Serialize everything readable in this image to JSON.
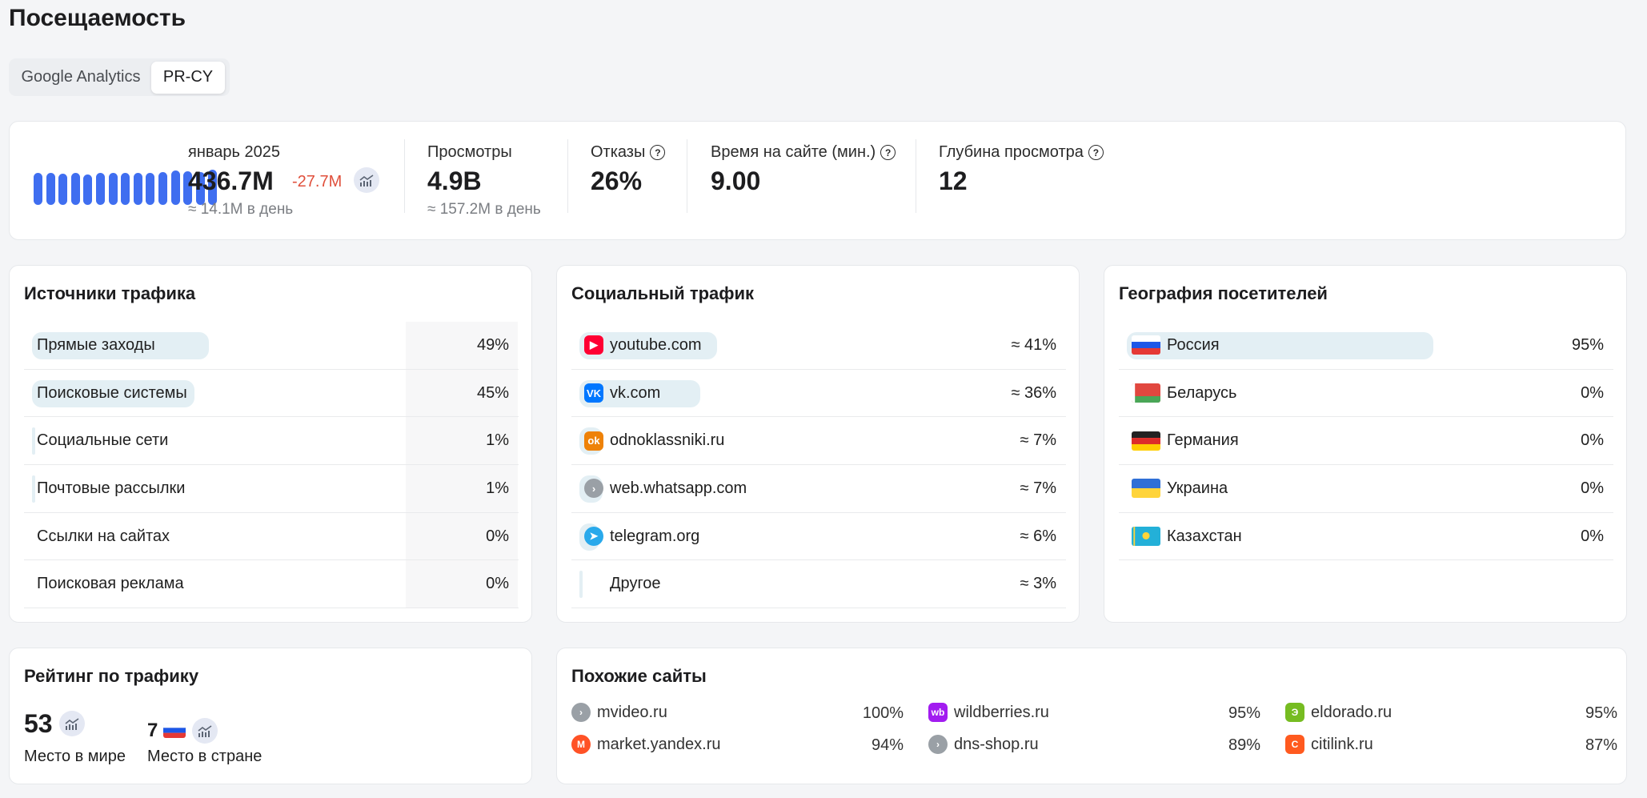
{
  "page": {
    "title": "Посещаемость"
  },
  "tabs": [
    {
      "label": "Google Analytics"
    },
    {
      "label": "PR-CY"
    }
  ],
  "summary": {
    "month": "январь 2025",
    "visits": "436.7M",
    "delta": "-27.7M",
    "per_day": "≈ 14.1M в день",
    "sparkline": [
      0.86,
      0.88,
      0.84,
      0.86,
      0.83,
      0.86,
      0.88,
      0.86,
      0.88,
      0.86,
      0.9,
      0.93,
      0.91,
      0.9,
      0.96
    ],
    "views_label": "Просмотры",
    "views": "4.9B",
    "views_per_day": "≈ 157.2M в день",
    "bounce_label": "Отказы",
    "bounce": "26%",
    "time_label": "Время на сайте (мин.)",
    "time": "9.00",
    "depth_label": "Глубина просмотра",
    "depth": "12"
  },
  "traffic_sources": {
    "title": "Источники трафика",
    "rows": [
      {
        "label": "Прямые заходы",
        "pct": "49%",
        "share": 0.49
      },
      {
        "label": "Поисковые системы",
        "pct": "45%",
        "share": 0.45
      },
      {
        "label": "Социальные сети",
        "pct": "1%",
        "share": 0.01
      },
      {
        "label": "Почтовые рассылки",
        "pct": "1%",
        "share": 0.01
      },
      {
        "label": "Ссылки на сайтах",
        "pct": "0%",
        "share": 0
      },
      {
        "label": "Поисковая реклама",
        "pct": "0%",
        "share": 0
      }
    ]
  },
  "social_traffic": {
    "title": "Социальный трафик",
    "rows": [
      {
        "label": "youtube.com",
        "pct": "≈ 41%",
        "share": 0.41,
        "icon": "youtube-icon",
        "color": "#ff0033"
      },
      {
        "label": "vk.com",
        "pct": "≈ 36%",
        "share": 0.36,
        "icon": "vk-icon",
        "color": "#0077ff"
      },
      {
        "label": "odnoklassniki.ru",
        "pct": "≈ 7%",
        "share": 0.07,
        "icon": "odnoklassniki-icon",
        "color": "#ee8208"
      },
      {
        "label": "web.whatsapp.com",
        "pct": "≈ 7%",
        "share": 0.07,
        "icon": "link-icon",
        "color": "#9aa0a6"
      },
      {
        "label": "telegram.org",
        "pct": "≈ 6%",
        "share": 0.06,
        "icon": "telegram-icon",
        "color": "#29a9eb"
      },
      {
        "label": "Другое",
        "pct": "≈ 3%",
        "share": 0.03,
        "icon": "",
        "color": ""
      }
    ]
  },
  "geography": {
    "title": "География посетителей",
    "rows": [
      {
        "label": "Россия",
        "pct": "95%",
        "share": 0.95,
        "flag": "russia-flag"
      },
      {
        "label": "Беларусь",
        "pct": "0%",
        "share": 0,
        "flag": "belarus-flag"
      },
      {
        "label": "Германия",
        "pct": "0%",
        "share": 0,
        "flag": "germany-flag"
      },
      {
        "label": "Украина",
        "pct": "0%",
        "share": 0,
        "flag": "ukraine-flag"
      },
      {
        "label": "Казахстан",
        "pct": "0%",
        "share": 0,
        "flag": "kazakhstan-flag"
      }
    ]
  },
  "ranking": {
    "title": "Рейтинг по трафику",
    "world_rank": "53",
    "world_label": "Место в мире",
    "country_rank": "7",
    "country_label": "Место в стране"
  },
  "similar": {
    "title": "Похожие сайты",
    "sites": [
      {
        "name": "mvideo.ru",
        "pct": "100%",
        "icon": "link-icon",
        "color": "#9aa0a6"
      },
      {
        "name": "wildberries.ru",
        "pct": "95%",
        "icon": "wildberries-icon",
        "color": "#a21cf0"
      },
      {
        "name": "eldorado.ru",
        "pct": "95%",
        "icon": "eldorado-icon",
        "color": "#76bc21"
      },
      {
        "name": "market.yandex.ru",
        "pct": "94%",
        "icon": "yandex-market-icon",
        "color": "#ff5226"
      },
      {
        "name": "dns-shop.ru",
        "pct": "89%",
        "icon": "link-icon",
        "color": "#9aa0a6"
      },
      {
        "name": "citilink.ru",
        "pct": "87%",
        "icon": "citilink-icon",
        "color": "#ff5a1f"
      }
    ]
  }
}
